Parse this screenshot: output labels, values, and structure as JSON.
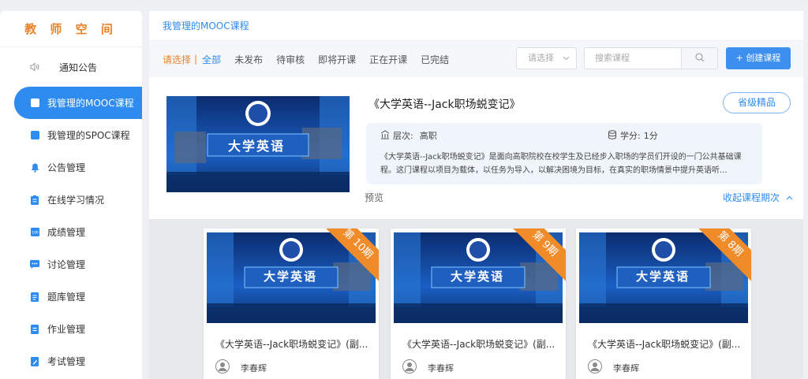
{
  "sidebar": {
    "title": "教 师 空 间",
    "items": [
      {
        "label": "通知公告",
        "icon": "speaker-icon"
      },
      {
        "label": "我管理的MOOC课程",
        "icon": "book-icon"
      },
      {
        "label": "我管理的SPOC课程",
        "icon": "book-icon"
      },
      {
        "label": "公告管理",
        "icon": "bell-icon"
      },
      {
        "label": "在线学习情况",
        "icon": "clipboard-icon"
      },
      {
        "label": "成绩管理",
        "icon": "grade-icon"
      },
      {
        "label": "讨论管理",
        "icon": "chat-icon"
      },
      {
        "label": "题库管理",
        "icon": "question-bank-icon"
      },
      {
        "label": "作业管理",
        "icon": "homework-icon"
      },
      {
        "label": "考试管理",
        "icon": "exam-icon"
      }
    ]
  },
  "breadcrumb": "我管理的MOOC课程",
  "filter": {
    "prompt": "请选择",
    "sep": "|",
    "options": [
      "全部",
      "未发布",
      "待审核",
      "即将开课",
      "正在开课",
      "已完结"
    ],
    "select_placeholder": "请选择",
    "search_placeholder": "搜索课程",
    "create_label": "+ 创建课程"
  },
  "course": {
    "title": "《大学英语--Jack职场蜕变记》",
    "badge": "省级精品",
    "level_label": "层次:",
    "level_value": "高职",
    "credit_label": "学分:",
    "credit_value": "1分",
    "description": "《大学英语--Jack职场蜕变记》是面向高职院校在校学生及已经步入职场的学员们开设的一门公共基础课程。这门课程以项目为载体，以任务为导入，以解决困境为目标，在真实的职场情景中提升英语听...",
    "preview": "预览",
    "collapse": "收起课程期次",
    "thumb_text": "大学英语"
  },
  "cards": [
    {
      "term": "第 10期",
      "title": "《大学英语--Jack职场蜕变记》(副...",
      "author": "李春辉"
    },
    {
      "term": "第 9期",
      "title": "《大学英语--Jack职场蜕变记》(副...",
      "author": "李春辉"
    },
    {
      "term": "第 8期",
      "title": "《大学英语--Jack职场蜕变记》(副...",
      "author": "李春辉"
    }
  ],
  "colors": {
    "accent": "#2e8bef",
    "orange": "#e8832a",
    "ribbon": "#f08b2a"
  }
}
